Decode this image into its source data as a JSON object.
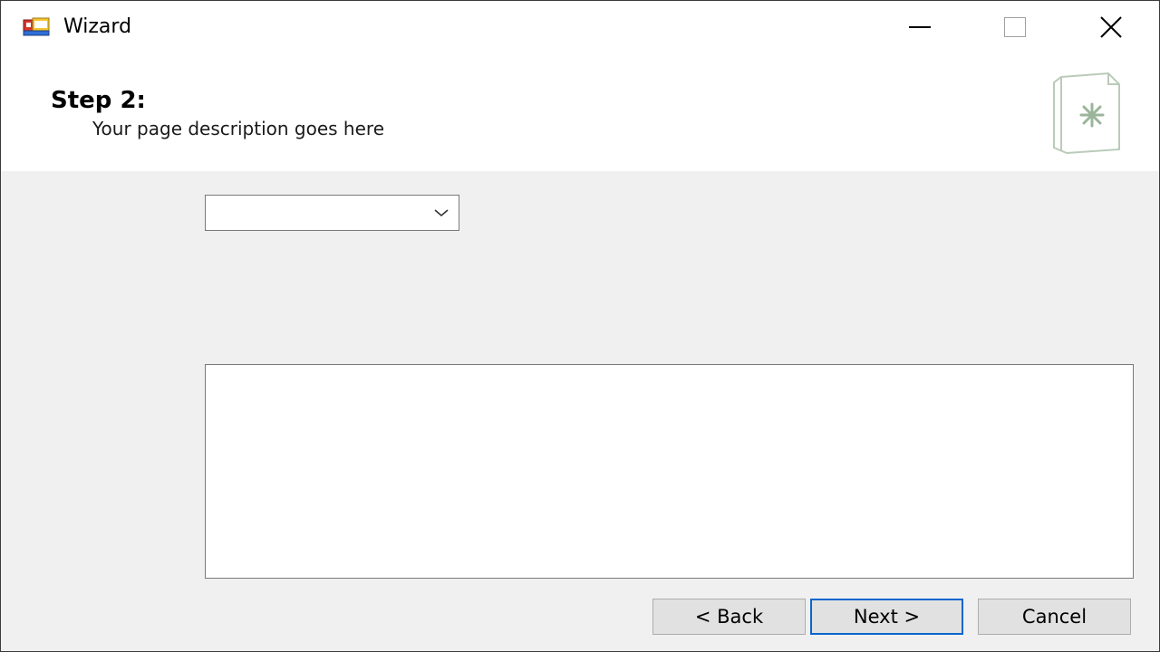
{
  "window": {
    "title": "Wizard",
    "icon": "app-window-icon"
  },
  "header": {
    "step_title": "Step 2:",
    "description": "Your page description goes here",
    "icon": "wizard-page-icon"
  },
  "form": {
    "combo_value": "",
    "textarea_value": ""
  },
  "buttons": {
    "back": "< Back",
    "next": "Next >",
    "cancel": "Cancel"
  },
  "colors": {
    "focus_border": "#0a66cc",
    "body_background": "#f0f0f0",
    "header_icon_stroke": "#9bb59b"
  }
}
